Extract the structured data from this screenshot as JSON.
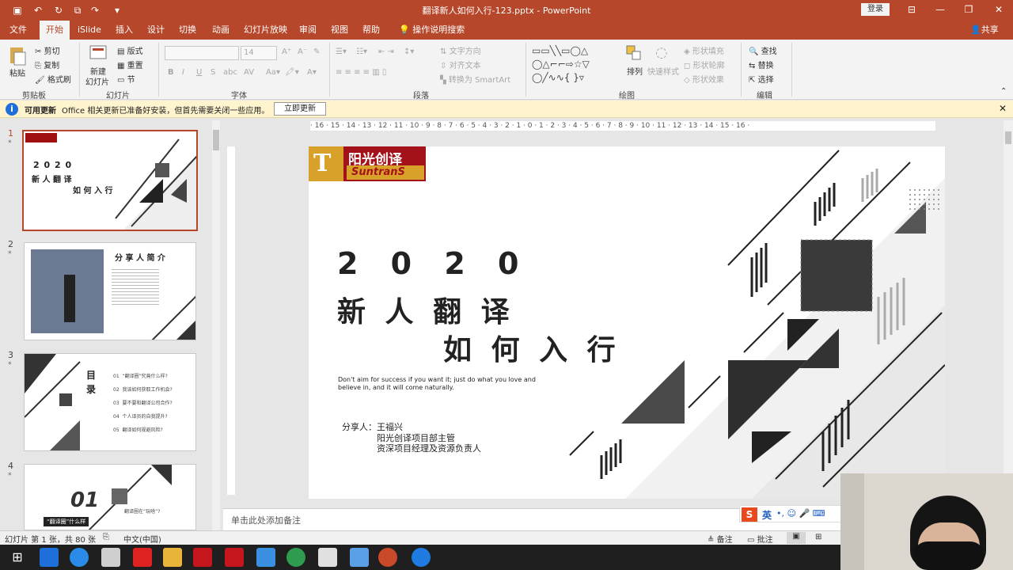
{
  "window": {
    "title": "翻译新人如何入行-123.pptx - PowerPoint",
    "login_label": "登录"
  },
  "tabs": [
    {
      "label": "文件"
    },
    {
      "label": "开始"
    },
    {
      "label": "iSlide"
    },
    {
      "label": "插入"
    },
    {
      "label": "设计"
    },
    {
      "label": "切换"
    },
    {
      "label": "动画"
    },
    {
      "label": "幻灯片放映"
    },
    {
      "label": "审阅"
    },
    {
      "label": "视图"
    },
    {
      "label": "帮助"
    },
    {
      "label": "操作说明搜索"
    }
  ],
  "share_label": "共享",
  "ribbon": {
    "clipboard": {
      "paste": "粘贴",
      "cut": "剪切",
      "copy": "复制",
      "format_painter": "格式刷",
      "group": "剪贴板"
    },
    "slides": {
      "new_slide_1": "新建",
      "new_slide_2": "幻灯片",
      "layout": "版式",
      "reset": "重置",
      "section": "节",
      "group": "幻灯片"
    },
    "font": {
      "size": "14",
      "group": "字体",
      "buttons": [
        "B",
        "I",
        "U",
        "S",
        "abc",
        "AV"
      ]
    },
    "paragraph": {
      "text_direction": "文字方向",
      "align_text": "对齐文本",
      "smartart": "转换为 SmartArt",
      "group": "段落"
    },
    "drawing": {
      "arrange": "排列",
      "quick_styles": "快速样式",
      "shape_fill": "形状填充",
      "shape_outline": "形状轮廓",
      "shape_effects": "形状效果",
      "group": "绘图"
    },
    "editing": {
      "find": "查找",
      "replace": "替换",
      "select": "选择",
      "group": "编辑"
    }
  },
  "infobar": {
    "title": "可用更新",
    "message": "Office 相关更新已准备好安装，但首先需要关闭一些应用。",
    "button": "立即更新"
  },
  "thumbnails": [
    {
      "num": "1",
      "star": "*",
      "title1": "2 0 2 0",
      "title2": "新 人 翻 译",
      "title3": "如 何 入 行"
    },
    {
      "num": "2",
      "star": "*",
      "title": "分 享 人 简 介"
    },
    {
      "num": "3",
      "star": "*",
      "title1": "目",
      "title2": "录",
      "items": [
        {
          "n": "01",
          "text": "“翻译圈”究竟什么样?"
        },
        {
          "n": "02",
          "text": "我该如何获取工作机会?"
        },
        {
          "n": "03",
          "text": "要不要和翻译公司合作?"
        },
        {
          "n": "04",
          "text": "个人译员的自我提升?"
        },
        {
          "n": "05",
          "text": "翻译如何规避风险?"
        }
      ]
    },
    {
      "num": "4",
      "star": "*",
      "big": "01",
      "tag": "“翻译圈”什么样",
      "q": "翻译圈在“玩啥”?"
    }
  ],
  "ruler": {
    "h_ticks": "· 16 · 15 · 14 · 13 · 12 · 11 · 10 · 9 · 8 · 7 · 6 · 5 · 4 · 3 · 2 · 1 · 0 · 1 · 2 · 3 · 4 · 5 · 6 · 7 · 8 · 9 · 10 · 11 · 12 · 13 · 14 · 15 · 16 ·"
  },
  "slide": {
    "logo_cn": "阳光创译",
    "logo_en": "SuntranS",
    "year": "2 0 2 0",
    "line2": "新 人 翻 译",
    "line3": "如 何 入 行",
    "quote1": "Don't aim for success if you want it; just do what you love and",
    "quote2": "believe in, and it will come naturally.",
    "presenter_label": "分享人：",
    "presenter_name": "王福兴",
    "presenter_role1": "阳光创译项目部主管",
    "presenter_role2": "资深项目经理及资源负责人"
  },
  "notes_placeholder": "单击此处添加备注",
  "status": {
    "slide_info": "幻灯片 第 1 张，共 80 张",
    "language": "中文(中国)",
    "notes": "备注",
    "comments": "批注"
  },
  "ime": {
    "label": "英"
  },
  "colors": {
    "accent": "#b7472a",
    "infobar": "#fff4ce",
    "taskbar": "#1f1f1f"
  }
}
